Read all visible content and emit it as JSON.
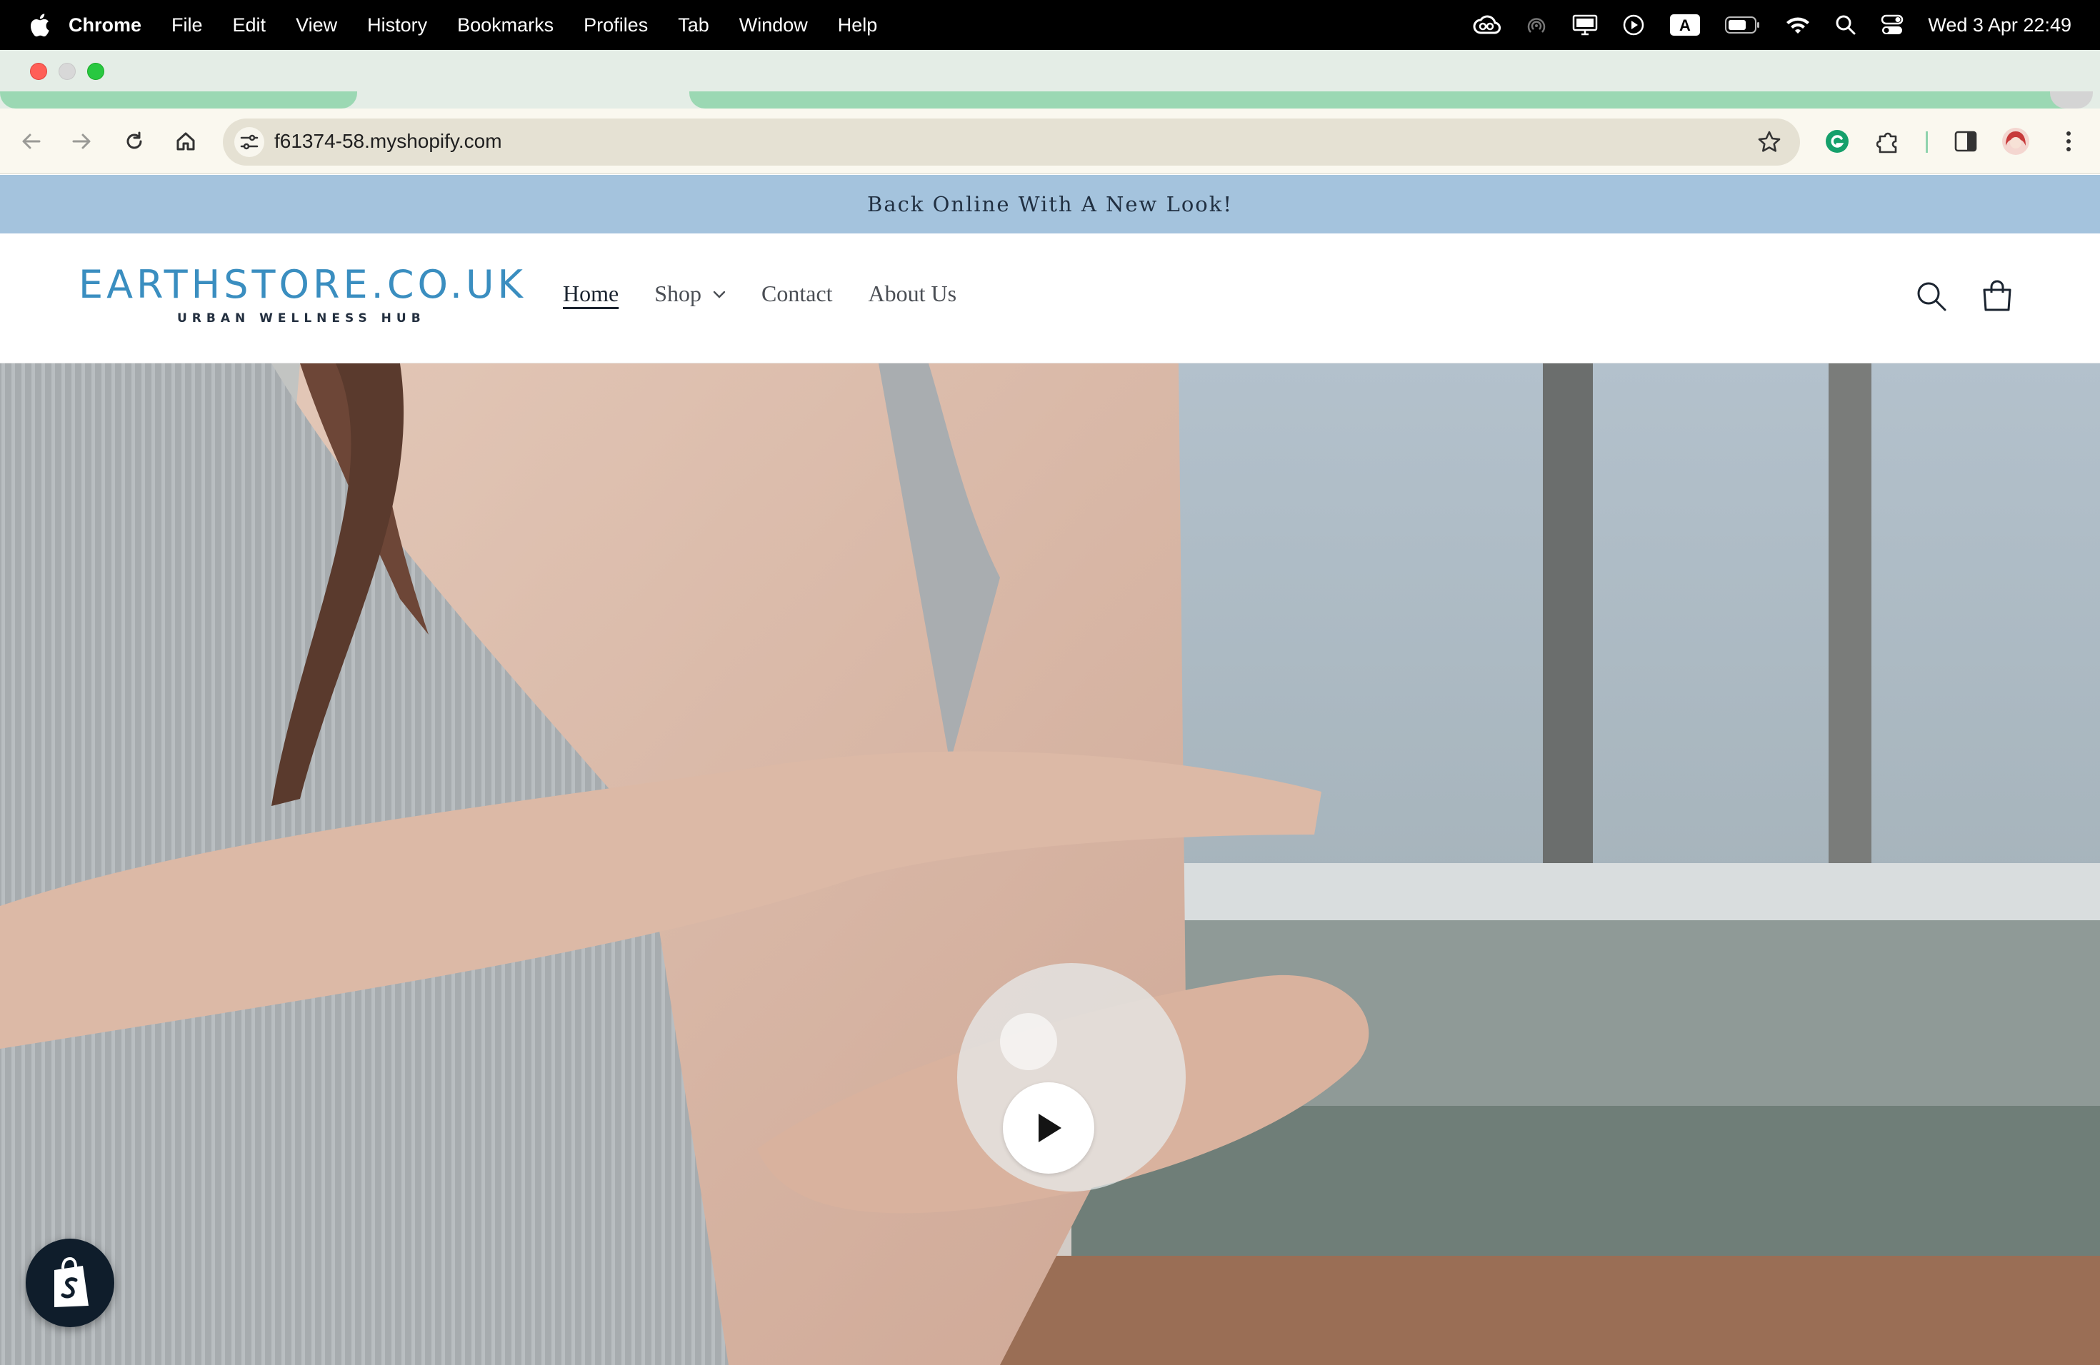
{
  "menubar": {
    "app_name": "Chrome",
    "items": [
      "File",
      "Edit",
      "View",
      "History",
      "Bookmarks",
      "Profiles",
      "Tab",
      "Window",
      "Help"
    ],
    "clock": "Wed 3 Apr  22:49",
    "status_icons": [
      "creative-cloud-icon",
      "airdrop-icon",
      "display-icon",
      "play-circle-icon",
      "keyboard-input-icon",
      "battery-icon",
      "wifi-icon",
      "spotlight-search-icon",
      "control-center-icon"
    ],
    "input_source_label": "A"
  },
  "browser": {
    "url": "f61374-58.myshopify.com",
    "accent_color": "#9bd8b3"
  },
  "store": {
    "announcement": "Back Online With A New Look!",
    "logo_name": "EARTHSTORE.CO.UK",
    "logo_tagline": "URBAN WELLNESS HUB",
    "nav": {
      "home": "Home",
      "shop": "Shop",
      "contact": "Contact",
      "about": "About Us"
    },
    "announcement_bg": "#a4c3dd",
    "logo_color": "#3a8ec0"
  },
  "hero": {
    "media": "video",
    "play_icon": "play-icon"
  }
}
